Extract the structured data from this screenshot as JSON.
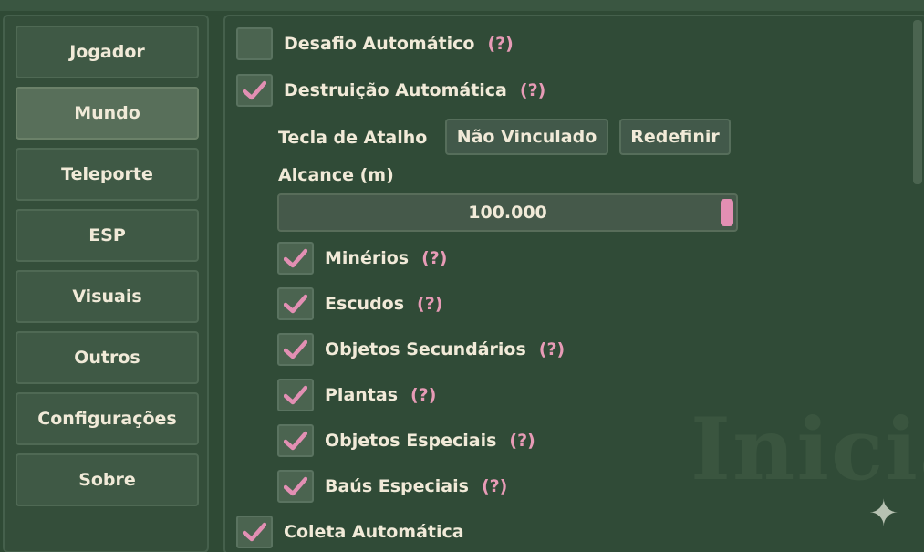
{
  "colors": {
    "background": "#2f4a35",
    "check": "#e28fb3",
    "help": "#e79bb6",
    "text": "#f1ead8"
  },
  "sidebar": {
    "items": [
      {
        "label": "Jogador",
        "active": false
      },
      {
        "label": "Mundo",
        "active": true
      },
      {
        "label": "Teleporte",
        "active": false
      },
      {
        "label": "ESP",
        "active": false
      },
      {
        "label": "Visuais",
        "active": false
      },
      {
        "label": "Outros",
        "active": false
      },
      {
        "label": "Configurações",
        "active": false
      },
      {
        "label": "Sobre",
        "active": false
      }
    ]
  },
  "main": {
    "help_marker": "(?)",
    "auto_challenge": {
      "label": "Desafio Automático",
      "checked": false
    },
    "auto_destruction": {
      "label": "Destruição Automática",
      "checked": true
    },
    "hotkey": {
      "label": "Tecla de Atalho",
      "value": "Não Vinculado",
      "reset_label": "Redefinir"
    },
    "range": {
      "label": "Alcance (m)",
      "value": "100.000",
      "level": 1.0
    },
    "options": [
      {
        "label": "Minérios",
        "checked": true
      },
      {
        "label": "Escudos",
        "checked": true
      },
      {
        "label": "Objetos Secundários",
        "checked": true
      },
      {
        "label": "Plantas",
        "checked": true
      },
      {
        "label": "Objetos Especiais",
        "checked": true
      },
      {
        "label": "Baús Especiais",
        "checked": true
      }
    ],
    "auto_collect": {
      "label": "Coleta Automática",
      "checked": true
    },
    "watermark": "Inicia"
  },
  "icons": {
    "check": "check-icon",
    "sparkle": "sparkle-icon"
  }
}
